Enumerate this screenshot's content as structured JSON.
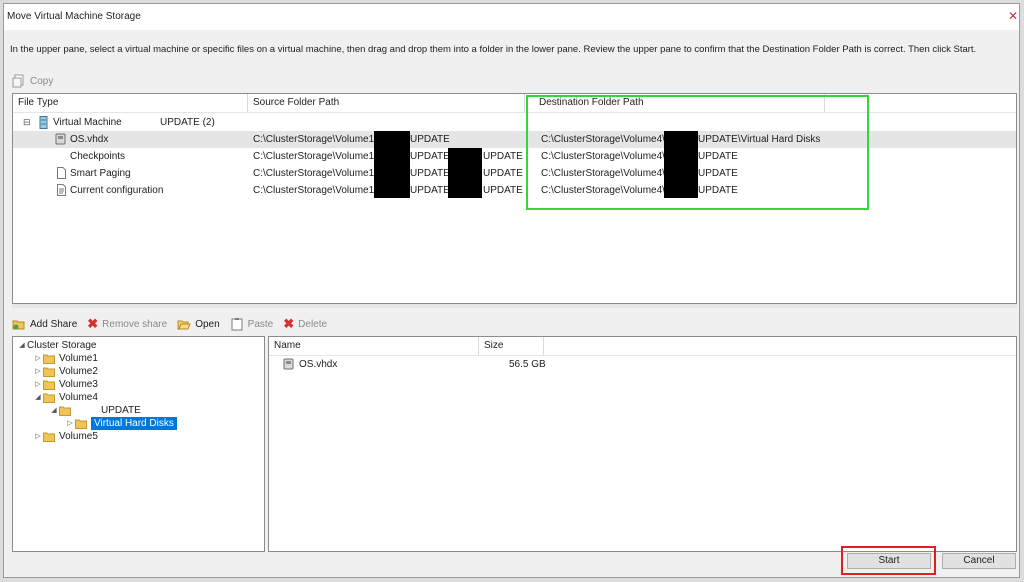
{
  "window": {
    "title": "Move Virtual Machine Storage"
  },
  "instructions": "In the upper pane, select a virtual machine or specific files on a virtual machine, then drag and drop them into a folder in the lower pane.  Review the upper pane to confirm that the Destination Folder Path is correct. Then click Start.",
  "top_toolbar": {
    "copy_label": "Copy"
  },
  "upper": {
    "columns": {
      "file_type": "File Type",
      "source": "Source Folder Path",
      "destination": "Destination Folder Path"
    },
    "vm": {
      "label": "Virtual Machine",
      "name": "UPDATE (2)"
    },
    "rows": [
      {
        "label": "OS.vhdx",
        "icon": "disk-icon",
        "source_a": "C:\\ClusterStorage\\Volume1\\",
        "source_b": "UPDATE",
        "source_c": "",
        "dest_a": "C:\\ClusterStorage\\Volume4\\",
        "dest_b": "UPDATE\\Virtual Hard Disks"
      },
      {
        "label": "Checkpoints",
        "icon": "none",
        "source_a": "C:\\ClusterStorage\\Volume1\\",
        "source_b": "UPDATE\\",
        "source_c": "UPDATE",
        "dest_a": "C:\\ClusterStorage\\Volume4\\",
        "dest_b": "UPDATE"
      },
      {
        "label": "Smart Paging",
        "icon": "document-icon",
        "source_a": "C:\\ClusterStorage\\Volume1\\",
        "source_b": "UPDATE\\",
        "source_c": "UPDATE",
        "dest_a": "C:\\ClusterStorage\\Volume4\\",
        "dest_b": "UPDATE"
      },
      {
        "label": "Current configuration",
        "icon": "config-icon",
        "source_a": "C:\\ClusterStorage\\Volume1\\",
        "source_b": "UPDATE\\",
        "source_c": "UPDATE",
        "dest_a": "C:\\ClusterStorage\\Volume4\\",
        "dest_b": "UPDATE"
      }
    ]
  },
  "bottom_toolbar": {
    "add_share": "Add Share",
    "remove_share": "Remove share",
    "open": "Open",
    "paste": "Paste",
    "delete": "Delete"
  },
  "tree": {
    "root": "Cluster Storage",
    "volume1": "Volume1",
    "volume2": "Volume2",
    "volume3": "Volume3",
    "volume4": "Volume4",
    "update_folder": "UPDATE",
    "virtual_hard_disks": "Virtual Hard Disks",
    "volume5": "Volume5"
  },
  "files": {
    "columns": {
      "name": "Name",
      "size": "Size"
    },
    "items": [
      {
        "name": "OS.vhdx",
        "size": "56.5 GB"
      }
    ]
  },
  "buttons": {
    "start": "Start",
    "cancel": "Cancel"
  },
  "colors": {
    "highlight_green": "#35d635",
    "highlight_red": "#e02020",
    "selection": "#0078d7"
  }
}
